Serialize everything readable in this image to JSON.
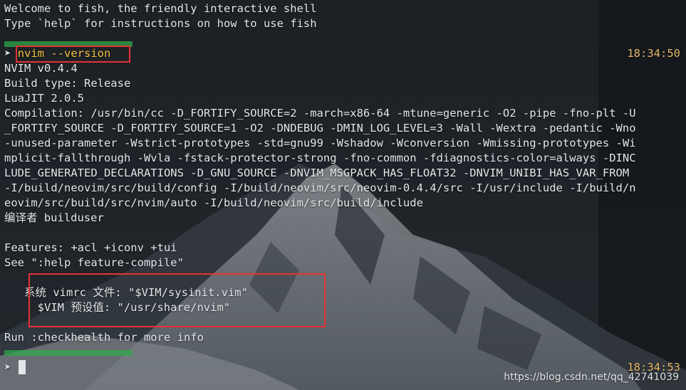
{
  "welcome": {
    "line1": "Welcome to fish, the friendly interactive shell",
    "line2": "Type `help` for instructions on how to use fish"
  },
  "prompt1": {
    "arrow": "➤",
    "command": "nvim --version",
    "time": "18:34:50"
  },
  "output": {
    "version": "NVIM v0.4.4",
    "build_type": "Build type: Release",
    "luajit": "LuaJIT 2.0.5",
    "compilation_lines": [
      "Compilation: /usr/bin/cc -D_FORTIFY_SOURCE=2 -march=x86-64 -mtune=generic -O2 -pipe -fno-plt -U",
      "_FORTIFY_SOURCE -D_FORTIFY_SOURCE=1 -O2 -DNDEBUG -DMIN_LOG_LEVEL=3 -Wall -Wextra -pedantic -Wno",
      "-unused-parameter -Wstrict-prototypes -std=gnu99 -Wshadow -Wconversion -Wmissing-prototypes -Wi",
      "mplicit-fallthrough -Wvla -fstack-protector-strong -fno-common -fdiagnostics-color=always -DINC",
      "LUDE_GENERATED_DECLARATIONS -D_GNU_SOURCE -DNVIM_MSGPACK_HAS_FLOAT32 -DNVIM_UNIBI_HAS_VAR_FROM",
      "-I/build/neovim/src/build/config -I/build/neovim/src/neovim-0.4.4/src -I/usr/include -I/build/n",
      "eovim/src/build/src/nvim/auto -I/build/neovim/src/build/include"
    ],
    "compiler": "编译者 builduser",
    "features": "Features: +acl +iconv +tui",
    "see_help": "See \":help feature-compile\"",
    "sysinit": "   系统 vimrc 文件: \"$VIM/sysinit.vim\"",
    "vim_default": "     $VIM 预设值: \"/usr/share/nvim\"",
    "checkhealth": "Run :checkhealth for more info"
  },
  "prompt2": {
    "arrow": "➤",
    "time": "18:34:53"
  },
  "watermark": "https://blog.csdn.net/qq_42741039",
  "colors": {
    "text": "#e3e6ea",
    "command": "#f0c040",
    "time": "#e5b86a",
    "highlight_box": "#e53333",
    "prompt_bar": "#2fa84a"
  }
}
